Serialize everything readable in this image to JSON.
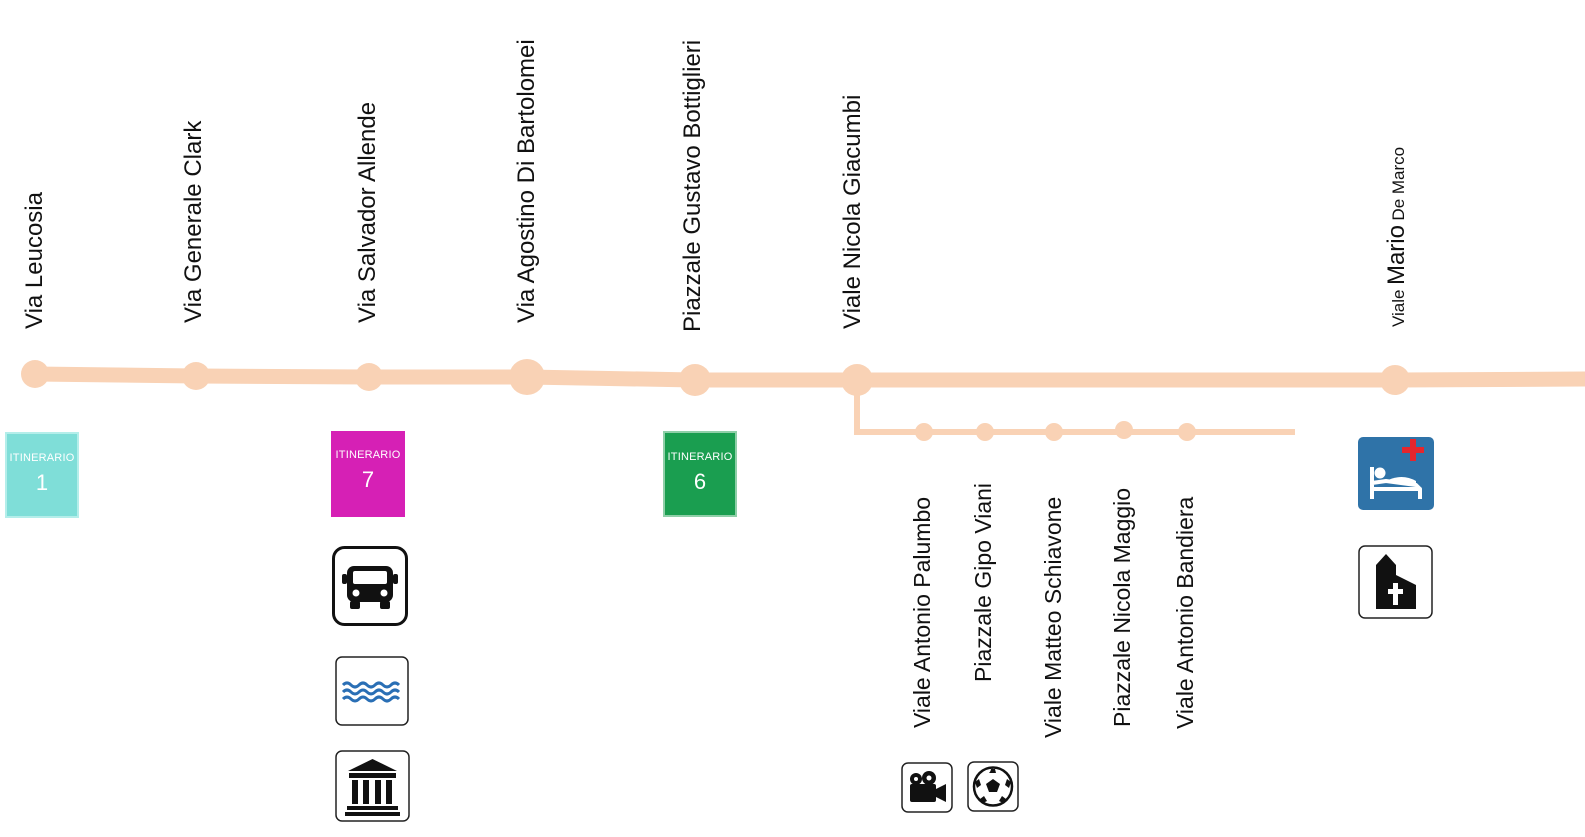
{
  "colors": {
    "line": "#f9d2b5",
    "itinerary_1": "#7fded8",
    "itinerary_7": "#d620b5",
    "itinerary_6": "#1a9e50",
    "hospital_bg": "#2f73a8",
    "hospital_cross": "#e5262d"
  },
  "stops": [
    {
      "name": "Via Leucosia"
    },
    {
      "name": "Via Generale Clark"
    },
    {
      "name": "Via Salvador Allende"
    },
    {
      "name": "Via Agostino Di Bartolomei"
    },
    {
      "name": "Piazzale Gustavo Bottiglieri"
    },
    {
      "name": "Viale Nicola Giacumbi"
    }
  ],
  "last_stop": {
    "part1": "Viale",
    "part2": "Mario",
    "part3": "De Marco"
  },
  "branch_stops": [
    {
      "name": "Viale Antonio Palumbo"
    },
    {
      "name": "Piazzale Gipo Viani"
    },
    {
      "name": "Viale Matteo Schiavone"
    },
    {
      "name": "Piazzale Nicola Maggio"
    },
    {
      "name": "Viale Antonio Bandiera"
    }
  ],
  "itineraries": [
    {
      "label": "ITINERARIO",
      "number": "1"
    },
    {
      "label": "ITINERARIO",
      "number": "7"
    },
    {
      "label": "ITINERARIO",
      "number": "6"
    }
  ],
  "icons": [
    "bus-icon",
    "sea-icon",
    "museum-icon",
    "hospital-icon",
    "church-icon",
    "cinema-icon",
    "football-icon"
  ]
}
